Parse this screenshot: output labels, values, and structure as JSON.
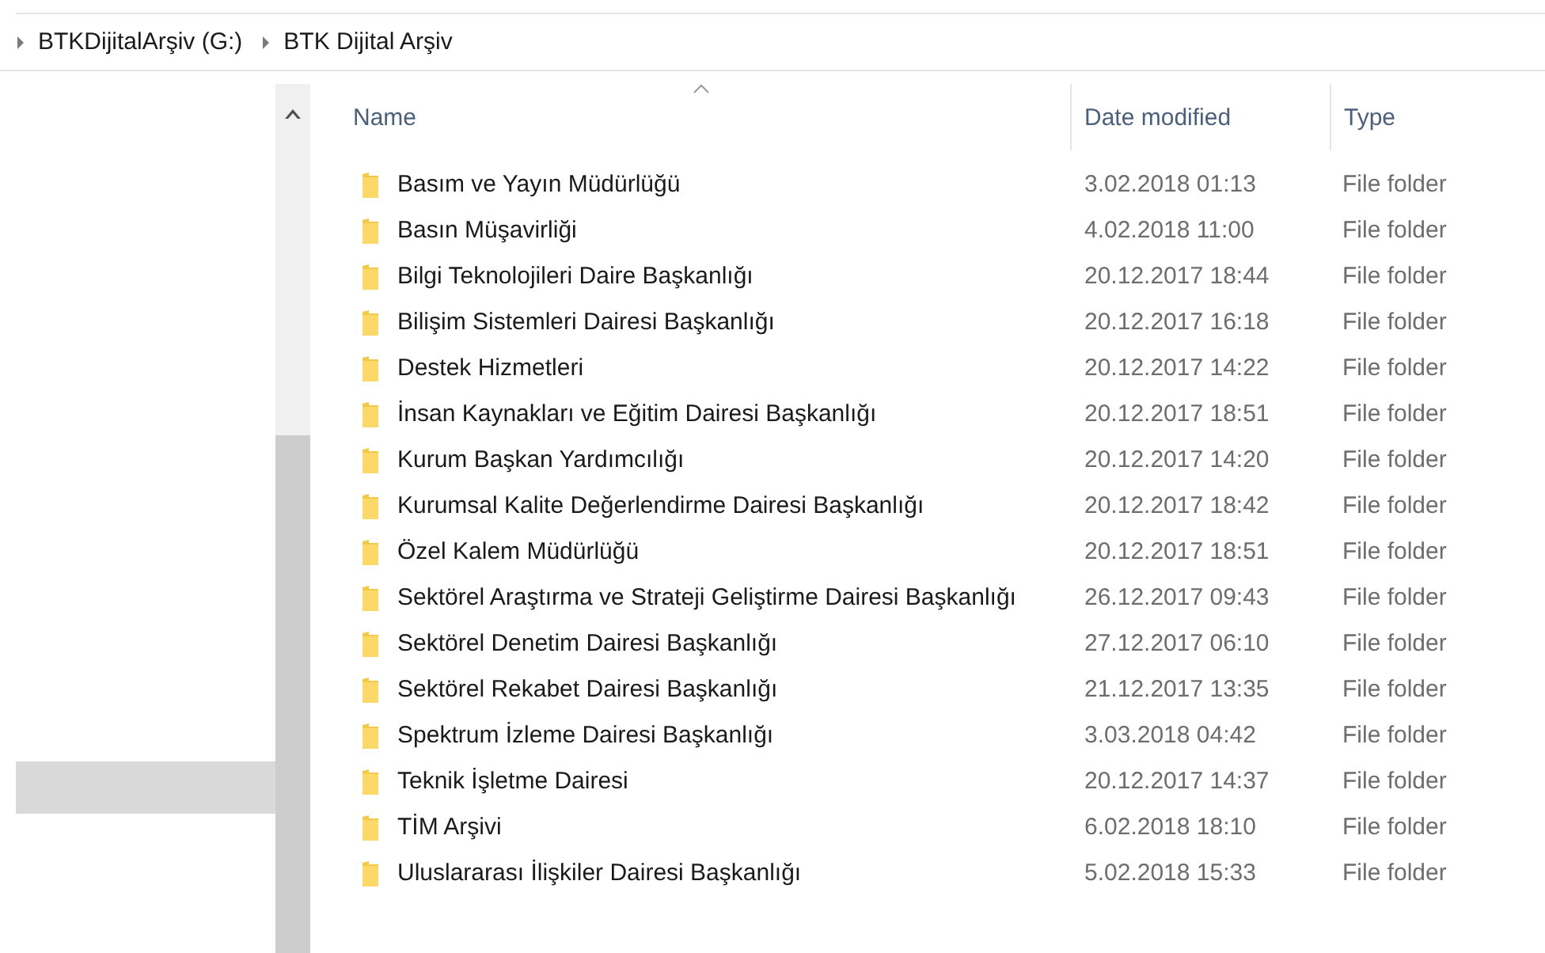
{
  "breadcrumb": [
    "BTKDijitalArşiv (G:)",
    "BTK Dijital Arşiv"
  ],
  "nav_pane": {
    "items": [
      {
        "selected": true
      }
    ]
  },
  "table": {
    "columns": [
      {
        "label": "Name",
        "sorted": true
      },
      {
        "label": "Date modified",
        "sorted": false
      },
      {
        "label": "Type",
        "sorted": false
      }
    ],
    "rows": [
      {
        "name": "Basım ve Yayın Müdürlüğü",
        "date": "3.02.2018 01:13",
        "type": "File folder"
      },
      {
        "name": "Basın Müşavirliği",
        "date": "4.02.2018 11:00",
        "type": "File folder"
      },
      {
        "name": "Bilgi Teknolojileri Daire Başkanlığı",
        "date": "20.12.2017 18:44",
        "type": "File folder"
      },
      {
        "name": "Bilişim Sistemleri Dairesi Başkanlığı",
        "date": "20.12.2017 16:18",
        "type": "File folder"
      },
      {
        "name": "Destek Hizmetleri",
        "date": "20.12.2017 14:22",
        "type": "File folder"
      },
      {
        "name": "İnsan Kaynakları ve Eğitim Dairesi Başkanlığı",
        "date": "20.12.2017 18:51",
        "type": "File folder"
      },
      {
        "name": "Kurum Başkan Yardımcılığı",
        "date": "20.12.2017 14:20",
        "type": "File folder"
      },
      {
        "name": "Kurumsal Kalite Değerlendirme Dairesi Başkanlığı",
        "date": "20.12.2017 18:42",
        "type": "File folder"
      },
      {
        "name": "Özel Kalem Müdürlüğü",
        "date": "20.12.2017 18:51",
        "type": "File folder"
      },
      {
        "name": "Sektörel Araştırma ve Strateji Geliştirme Dairesi Başkanlığı",
        "date": "26.12.2017 09:43",
        "type": "File folder"
      },
      {
        "name": "Sektörel Denetim Dairesi Başkanlığı",
        "date": "27.12.2017 06:10",
        "type": "File folder"
      },
      {
        "name": "Sektörel Rekabet Dairesi Başkanlığı",
        "date": "21.12.2017 13:35",
        "type": "File folder"
      },
      {
        "name": "Spektrum İzleme Dairesi Başkanlığı",
        "date": "3.03.2018 04:42",
        "type": "File folder"
      },
      {
        "name": "Teknik İşletme Dairesi",
        "date": "20.12.2017 14:37",
        "type": "File folder"
      },
      {
        "name": "TİM Arşivi",
        "date": "6.02.2018 18:10",
        "type": "File folder"
      },
      {
        "name": "Uluslararası İlişkiler Dairesi Başkanlığı",
        "date": "5.02.2018 15:33",
        "type": "File folder"
      }
    ]
  }
}
